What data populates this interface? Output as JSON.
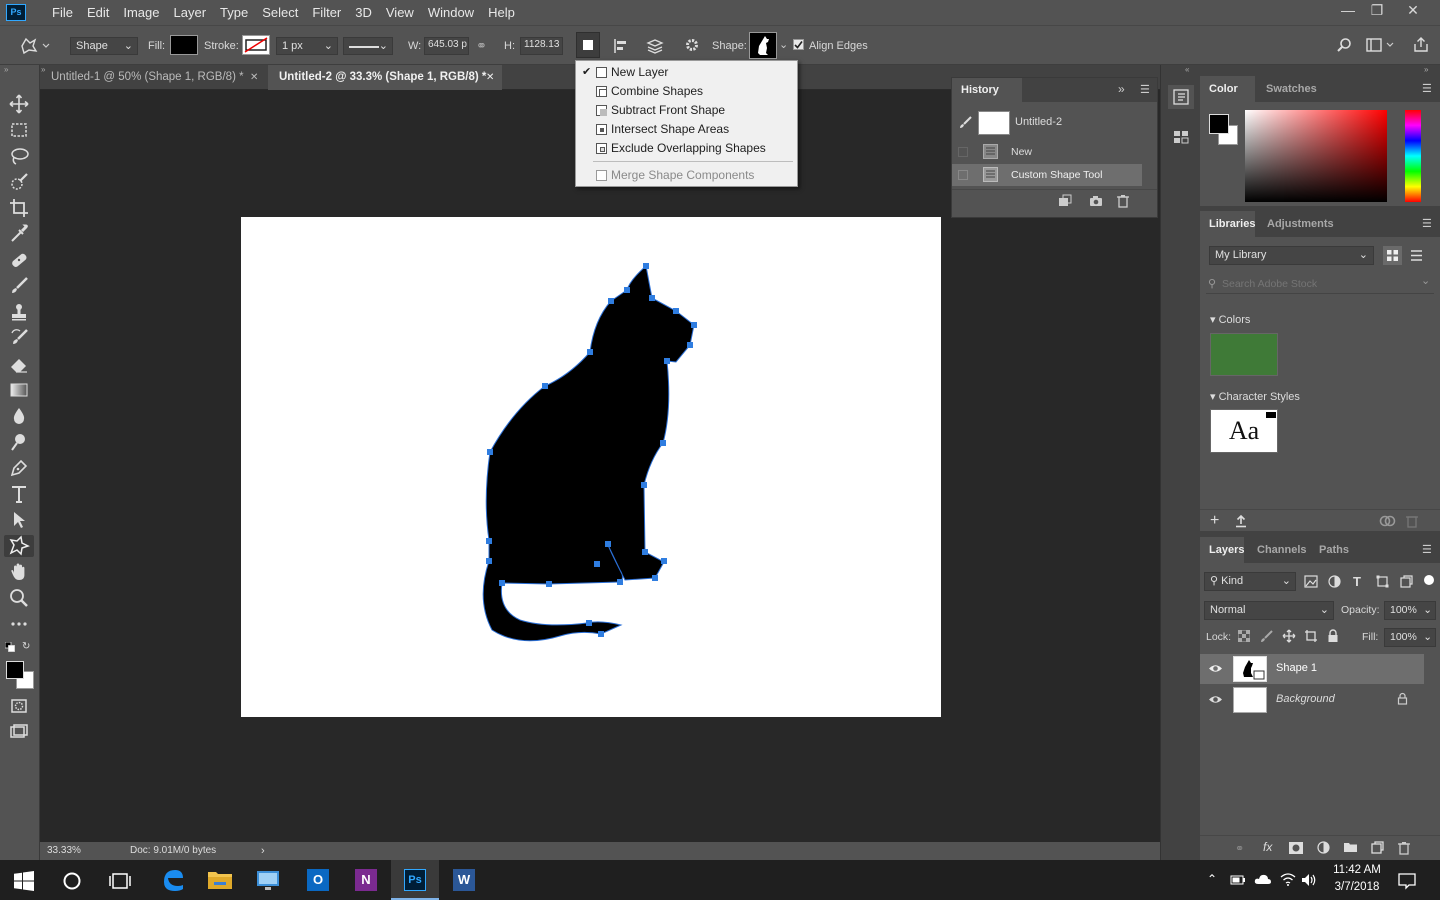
{
  "app": {
    "logo_text": "Ps",
    "menu": [
      "File",
      "Edit",
      "Image",
      "Layer",
      "Type",
      "Select",
      "Filter",
      "3D",
      "View",
      "Window",
      "Help"
    ],
    "window_controls": [
      "minimize",
      "restore",
      "close"
    ]
  },
  "options_bar": {
    "mode": "Shape",
    "fill_label": "Fill:",
    "stroke_label": "Stroke:",
    "stroke_width": "1 px",
    "w_label": "W:",
    "w_value": "645.03 p",
    "h_label": "H:",
    "h_value": "1128.13",
    "shape_label": "Shape:",
    "align_edges_label": "Align Edges",
    "align_edges_checked": true
  },
  "path_ops_menu": {
    "items": [
      {
        "label": "New Layer",
        "checked": true,
        "enabled": true
      },
      {
        "label": "Combine Shapes",
        "checked": false,
        "enabled": true
      },
      {
        "label": "Subtract Front Shape",
        "checked": false,
        "enabled": true
      },
      {
        "label": "Intersect Shape Areas",
        "checked": false,
        "enabled": true
      },
      {
        "label": "Exclude Overlapping Shapes",
        "checked": false,
        "enabled": true
      }
    ],
    "merge_label": "Merge Shape Components",
    "merge_enabled": false
  },
  "tabs": [
    {
      "label": "Untitled-1 @ 50% (Shape 1, RGB/8) *",
      "active": false
    },
    {
      "label": "Untitled-2 @ 33.3% (Shape 1, RGB/8) *",
      "active": true
    }
  ],
  "tools": [
    "move-icon",
    "marquee-icon",
    "lasso-icon",
    "quick-select-icon",
    "crop-icon",
    "eyedropper-icon",
    "healing-brush-icon",
    "brush-icon",
    "clone-stamp-icon",
    "history-brush-icon",
    "eraser-icon",
    "gradient-icon",
    "blur-icon",
    "dodge-icon",
    "pen-icon",
    "type-icon",
    "path-select-icon",
    "custom-shape-icon",
    "hand-icon",
    "zoom-icon",
    "more-tools-icon"
  ],
  "status": {
    "zoom": "33.33%",
    "doc_info": "Doc: 9.01M/0 bytes"
  },
  "history": {
    "title": "History",
    "snapshot": "Untitled-2",
    "states": [
      "New",
      "Custom Shape Tool"
    ]
  },
  "color_panel": {
    "tabs": [
      "Color",
      "Swatches"
    ],
    "hue_color": "#ff0000",
    "foreground": "#000000",
    "background": "#ffffff"
  },
  "libraries_panel": {
    "tabs": [
      "Libraries",
      "Adjustments"
    ],
    "library": "My Library",
    "search_placeholder": "Search Adobe Stock",
    "colors_title": "Colors",
    "swatch": "#3f7a37",
    "char_styles_title": "Character Styles",
    "char_sample": "Aa"
  },
  "layers_panel": {
    "tabs": [
      "Layers",
      "Channels",
      "Paths"
    ],
    "filter": "Kind",
    "blend": "Normal",
    "opacity_label": "Opacity:",
    "opacity": "100%",
    "lock_label": "Lock:",
    "fill_label": "Fill:",
    "fill": "100%",
    "layers": [
      {
        "name": "Shape 1",
        "selected": true
      },
      {
        "name": "Background",
        "selected": false
      }
    ]
  },
  "taskbar": {
    "time": "11:42 AM",
    "date": "3/7/2018",
    "apps": [
      "edge-icon",
      "file-explorer-icon",
      "remote-desktop-icon",
      "outlook-icon",
      "onenote-icon",
      "photoshop-icon",
      "word-icon"
    ],
    "app_letters": {
      "outlook": "O",
      "onenote": "N",
      "photoshop": "Ps",
      "word": "W"
    }
  }
}
